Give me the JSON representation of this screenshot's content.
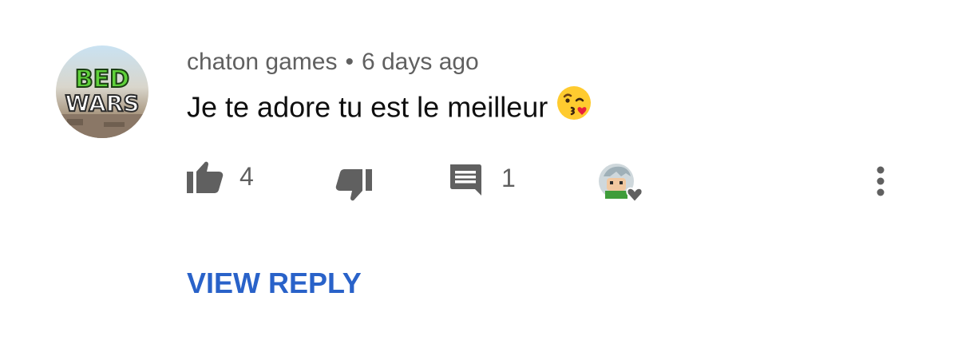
{
  "comment": {
    "author": "chaton games",
    "separator": "•",
    "time": "6 days ago",
    "text": "Je te adore tu est le meilleur",
    "emoji": "kissing-face-icon"
  },
  "avatar": {
    "line1": "BED",
    "line2": "WARS"
  },
  "actions": {
    "like_count": "4",
    "reply_count": "1"
  },
  "view_reply_label": "VIEW REPLY",
  "colors": {
    "meta": "#606060",
    "text": "#0f0f0f",
    "icon": "#606060",
    "link": "#2962c9",
    "avatar_logo": "#5fd13a"
  }
}
